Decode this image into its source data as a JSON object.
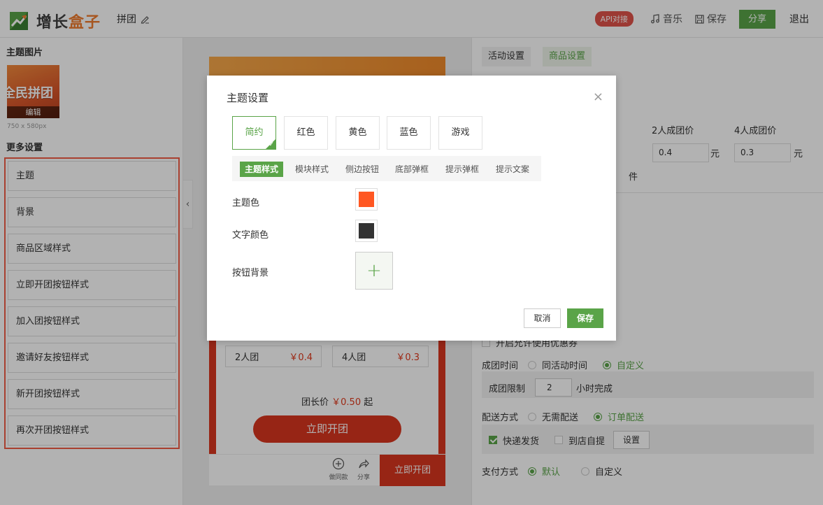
{
  "header": {
    "logo_text_main": "增长",
    "logo_text_accent": "盒子",
    "page_name": "拼团",
    "api_badge": "API对接",
    "music": "音乐",
    "save": "保存",
    "share": "分享",
    "exit": "退出"
  },
  "left_panel": {
    "theme_image_title": "主题图片",
    "thumb_text": "全民拼团",
    "thumb_edit": "编辑",
    "thumb_size": "750 x 580px",
    "more_settings_title": "更多设置",
    "items": [
      {
        "label": "主题"
      },
      {
        "label": "背景"
      },
      {
        "label": "商品区域样式"
      },
      {
        "label": "立即开团按钮样式"
      },
      {
        "label": "加入团按钮样式"
      },
      {
        "label": "邀请好友按钮样式"
      },
      {
        "label": "新开团按钮样式"
      },
      {
        "label": "再次开团按钮样式"
      }
    ]
  },
  "preview": {
    "price_boxes": [
      {
        "label": "2人团",
        "price": "￥0.4"
      },
      {
        "label": "4人团",
        "price": "￥0.3"
      }
    ],
    "leader_label": "团长价",
    "leader_price": "￥0.50",
    "leader_suffix": "起",
    "open_button": "立即开团",
    "bottom": {
      "same_style": "做同款",
      "share": "分享",
      "open": "立即开团"
    }
  },
  "right_panel": {
    "tabs": [
      {
        "label": "活动设置",
        "active": false
      },
      {
        "label": "商品设置",
        "active": true
      }
    ],
    "col_2": "2人成团价",
    "col_4": "4人成团价",
    "price_2": "0.4",
    "price_4": "0.3",
    "unit_yuan": "元",
    "unit_piece": "件",
    "coupon_text": "开启允许使用优惠券",
    "group_time_label": "成团时间",
    "group_time_opt1": "同活动时间",
    "group_time_opt2": "自定义",
    "group_limit_label": "成团限制",
    "group_limit_value": "2",
    "group_limit_suffix": "小时完成",
    "delivery_label": "配送方式",
    "delivery_opt1": "无需配送",
    "delivery_opt2": "订单配送",
    "express": "快递发货",
    "pickup": "到店自提",
    "settings_btn": "设置",
    "payment_label": "支付方式",
    "payment_opt1": "默认",
    "payment_opt2": "自定义"
  },
  "modal": {
    "title": "主题设置",
    "themes": [
      {
        "label": "简约",
        "active": true
      },
      {
        "label": "红色",
        "active": false
      },
      {
        "label": "黄色",
        "active": false
      },
      {
        "label": "蓝色",
        "active": false
      },
      {
        "label": "游戏",
        "active": false
      }
    ],
    "subtabs": [
      {
        "label": "主题样式",
        "active": true
      },
      {
        "label": "模块样式",
        "active": false
      },
      {
        "label": "侧边按钮",
        "active": false
      },
      {
        "label": "底部弹框",
        "active": false
      },
      {
        "label": "提示弹框",
        "active": false
      },
      {
        "label": "提示文案",
        "active": false
      }
    ],
    "theme_color_label": "主题色",
    "theme_color": "#ff5722",
    "text_color_label": "文字颜色",
    "text_color": "#333333",
    "button_bg_label": "按钮背景",
    "cancel": "取消",
    "save": "保存"
  },
  "colors": {
    "accent_green": "#5aa448",
    "highlight_red": "#f25c45",
    "preview_red": "#d9361f"
  }
}
